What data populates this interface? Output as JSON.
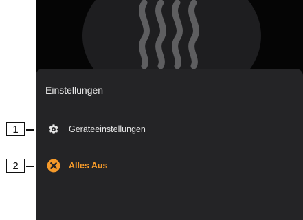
{
  "sheet": {
    "title": "Einstellungen",
    "items": [
      {
        "label": "Geräteeinstellungen",
        "icon": "gear-icon",
        "color": "#e6e6e6"
      },
      {
        "label": "Alles Aus",
        "icon": "cancel-circle-icon",
        "color": "#f59a2a"
      }
    ]
  },
  "callouts": [
    "1",
    "2"
  ]
}
